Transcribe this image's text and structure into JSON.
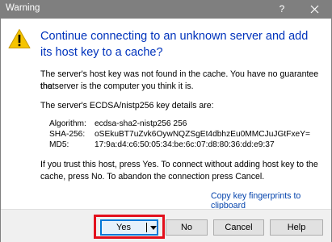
{
  "window": {
    "title": "Warning",
    "help_glyph": "?",
    "close_icon": "close-icon"
  },
  "icon": {
    "name": "warning-icon",
    "color": "#f5c400"
  },
  "heading": "Continue connecting to an unknown server and add its host key to a cache?",
  "body": {
    "line1": "The server's host key was not found in the cache. You have no guarantee that",
    "line2": "the server is the computer you think it is.",
    "details_label": "The server's ECDSA/nistp256 key details are:",
    "details": [
      {
        "key": "Algorithm:",
        "value": "ecdsa-sha2-nistp256 256"
      },
      {
        "key": "SHA-256:",
        "value": "oSEkuBT7uZvk6OywNQZSgEt4dbhzEu0MMCJuJGtFxeY="
      },
      {
        "key": "MD5:",
        "value": "17:9a:d4:c6:50:05:34:be:6c:07:d8:80:36:dd:e9:37"
      }
    ],
    "instr1": "If you trust this host, press Yes. To connect without adding host key to the",
    "instr2": "cache, press No. To abandon the connection press Cancel."
  },
  "link": "Copy key fingerprints to clipboard",
  "buttons": {
    "yes": "Yes",
    "yes_dropdown_icon": "dropdown-arrow-icon",
    "no": "No",
    "cancel": "Cancel",
    "help": "Help"
  },
  "colors": {
    "title_bar": "#7f7f7f",
    "heading": "#0033bc",
    "link": "#0645ad",
    "highlight": "#e3101c",
    "default_button_border": "#0078d7"
  }
}
